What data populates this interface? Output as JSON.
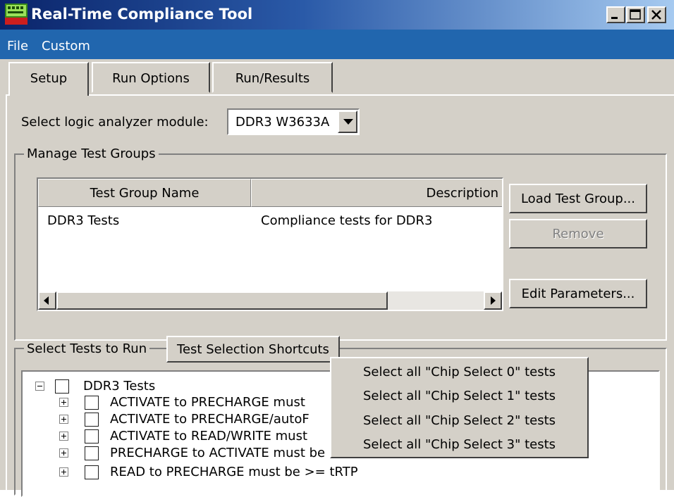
{
  "window": {
    "title": "Real-Time Compliance Tool",
    "icons": {
      "app": "logic-analyzer-app-icon",
      "minimize": "minimize-icon",
      "maximize": "maximize-icon",
      "close": "close-icon"
    }
  },
  "colors": {
    "menubar": "#2166ae",
    "window_bg": "#d4d0c8",
    "title_start": "#0a246a",
    "title_end": "#a6caf0"
  },
  "menubar": {
    "items": [
      "File",
      "Custom"
    ]
  },
  "tabs": [
    {
      "label": "Setup",
      "selected": true
    },
    {
      "label": "Run Options",
      "selected": false
    },
    {
      "label": "Run/Results",
      "selected": false
    }
  ],
  "setup": {
    "module_label": "Select logic analyzer module:",
    "module_value": "DDR3 W3633A",
    "manage_groups": {
      "title": "Manage Test Groups",
      "columns": [
        "Test Group Name",
        "Description"
      ],
      "rows": [
        {
          "name": "DDR3 Tests",
          "description": "Compliance tests for DDR3"
        }
      ],
      "buttons": {
        "load": "Load Test Group...",
        "remove": "Remove",
        "edit": "Edit Parameters..."
      }
    },
    "select_tests": {
      "title": "Select Tests to Run",
      "shortcuts_button": "Test Selection Shortcuts",
      "tree": {
        "root": {
          "label": "DDR3 Tests",
          "checked": false,
          "expanded": true
        },
        "children": [
          {
            "label": "ACTIVATE to PRECHARGE must",
            "checked": false
          },
          {
            "label": "ACTIVATE to PRECHARGE/autoF",
            "checked": false
          },
          {
            "label": "ACTIVATE to READ/WRITE must",
            "checked": false
          },
          {
            "label": "PRECHARGE to ACTIVATE must be >= tRP",
            "checked": false
          },
          {
            "label": "READ to PRECHARGE must be >= tRTP",
            "checked": false
          }
        ]
      }
    },
    "shortcuts_menu": [
      "Select all \"Chip Select 0\" tests",
      "Select all \"Chip Select 1\" tests",
      "Select all \"Chip Select 2\" tests",
      "Select all \"Chip Select 3\" tests"
    ]
  }
}
